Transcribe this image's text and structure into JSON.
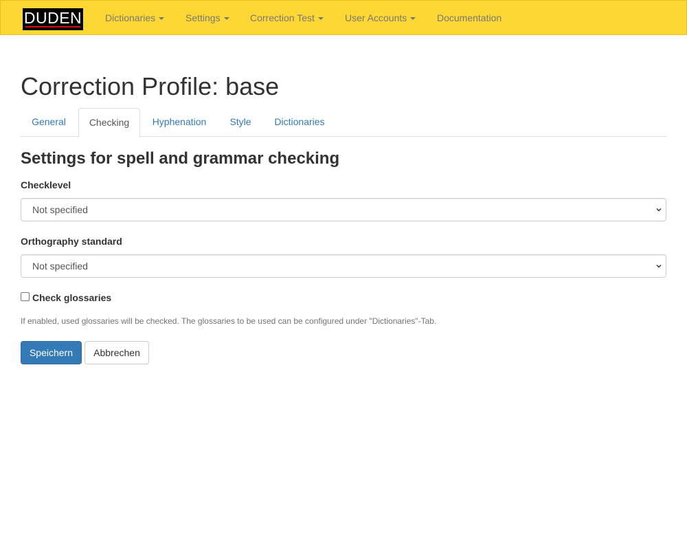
{
  "navbar": {
    "brand": "DUDEN",
    "items": [
      {
        "label": "Dictionaries",
        "dropdown": true
      },
      {
        "label": "Settings",
        "dropdown": true
      },
      {
        "label": "Correction Test",
        "dropdown": true
      },
      {
        "label": "User Accounts",
        "dropdown": true
      },
      {
        "label": "Documentation",
        "dropdown": false
      }
    ]
  },
  "page_title": "Correction Profile: base",
  "tabs": [
    {
      "label": "General",
      "active": false
    },
    {
      "label": "Checking",
      "active": true
    },
    {
      "label": "Hyphenation",
      "active": false
    },
    {
      "label": "Style",
      "active": false
    },
    {
      "label": "Dictionaries",
      "active": false
    }
  ],
  "section_title": "Settings for spell and grammar checking",
  "fields": {
    "checklevel": {
      "label": "Checklevel",
      "value": "Not specified"
    },
    "orthography": {
      "label": "Orthography standard",
      "value": "Not specified"
    }
  },
  "check_glossaries": {
    "label": "Check glossaries",
    "checked": false,
    "help": "If enabled, used glossaries will be checked. The glossaries to be used can be configured under \"Dictionaries\"-Tab."
  },
  "buttons": {
    "save": "Speichern",
    "cancel": "Abbrechen"
  },
  "colors": {
    "navbar": "#fdd835",
    "link": "#337ab7",
    "primary": "#337ab7"
  }
}
